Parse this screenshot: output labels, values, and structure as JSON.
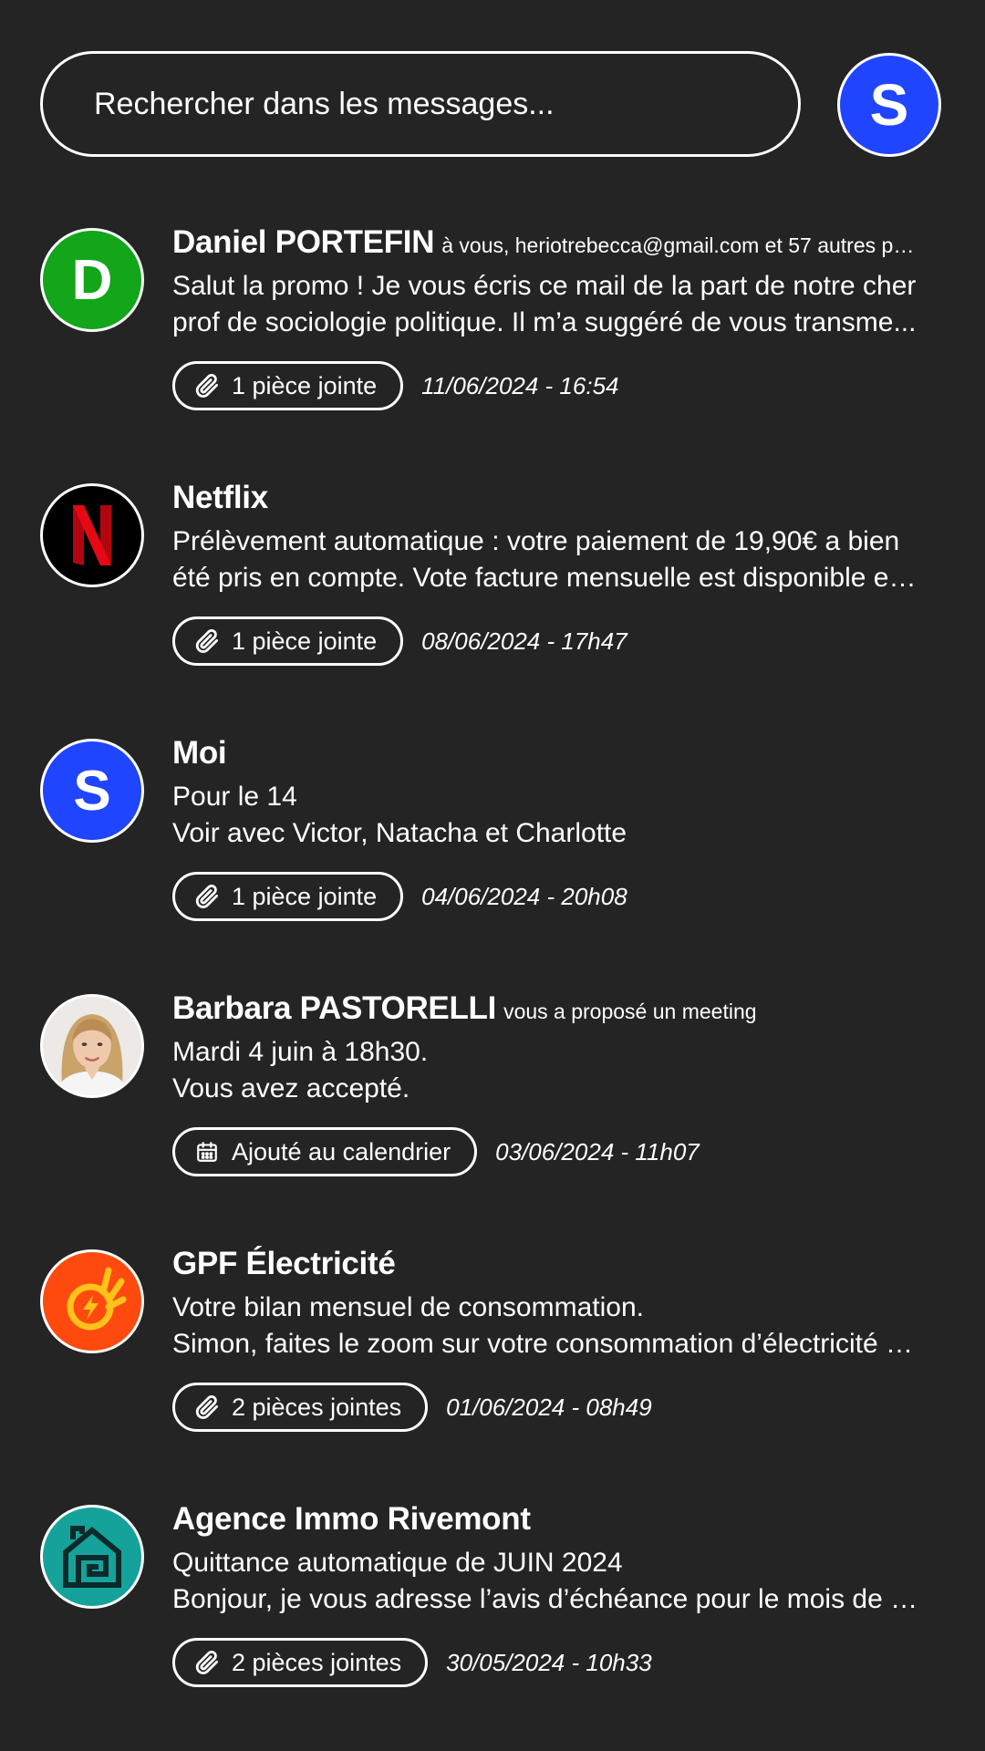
{
  "search": {
    "placeholder": "Rechercher dans les messages..."
  },
  "account": {
    "initial": "S",
    "color": "#2045ff"
  },
  "messages": [
    {
      "sender": "Daniel PORTEFIN",
      "recipients": "à vous, heriotrebecca@gmail.com et 57 autres pers...",
      "avatar": {
        "type": "initial",
        "initial": "D",
        "color": "#13a51a"
      },
      "lines": [
        "Salut la promo ! Je vous écris ce mail de la part de notre cher",
        "prof de sociologie politique. Il m’a suggéré de vous transme..."
      ],
      "chip": {
        "icon": "paperclip-icon",
        "label": "1 pièce jointe"
      },
      "date": "11/06/2024 - 16:54"
    },
    {
      "sender": "Netflix",
      "recipients": "",
      "avatar": {
        "type": "logo",
        "icon": "netflix-logo",
        "initial": "N",
        "color": "#000000",
        "accent": "#e50914"
      },
      "lines": [
        "Prélèvement automatique : votre paiement de 19,90€ a bien",
        "été pris en compte. Vote facture mensuelle est disponible en ..."
      ],
      "chip": {
        "icon": "paperclip-icon",
        "label": "1 pièce jointe"
      },
      "date": "08/06/2024 - 17h47"
    },
    {
      "sender": "Moi",
      "recipients": "",
      "avatar": {
        "type": "initial",
        "initial": "S",
        "color": "#2045ff"
      },
      "lines": [
        "Pour le 14",
        "Voir avec Victor, Natacha et Charlotte"
      ],
      "chip": {
        "icon": "paperclip-icon",
        "label": "1 pièce jointe"
      },
      "date": "04/06/2024 - 20h08"
    },
    {
      "sender": "Barbara PASTORELLI",
      "recipients": "vous a proposé un meeting",
      "avatar": {
        "type": "photo",
        "icon": "profile-photo",
        "color": "#d9d4cf"
      },
      "lines": [
        "Mardi 4 juin à 18h30.",
        "Vous avez accepté."
      ],
      "chip": {
        "icon": "calendar-icon",
        "label": "Ajouté au calendrier"
      },
      "date": "03/06/2024 - 11h07"
    },
    {
      "sender": "GPF Électricité",
      "recipients": "",
      "avatar": {
        "type": "logo",
        "icon": "ok-hand-lightning-logo",
        "color": "#ff4a0f",
        "accent": "#ffc21a"
      },
      "lines": [
        "Votre bilan mensuel de consommation.",
        "Simon, faites le zoom sur votre consommation d’électricité d..."
      ],
      "chip": {
        "icon": "paperclip-icon",
        "label": "2 pièces jointes"
      },
      "date": "01/06/2024 - 08h49"
    },
    {
      "sender": "Agence Immo Rivemont",
      "recipients": "",
      "avatar": {
        "type": "logo",
        "icon": "house-logo",
        "color": "#15a29a",
        "accent": "#0c2a2a"
      },
      "lines": [
        "Quittance automatique de JUIN 2024",
        "Bonjour, je vous adresse l’avis d’échéance pour le mois de ju..."
      ],
      "chip": {
        "icon": "paperclip-icon",
        "label": "2 pièces jointes"
      },
      "date": "30/05/2024 - 10h33"
    }
  ]
}
